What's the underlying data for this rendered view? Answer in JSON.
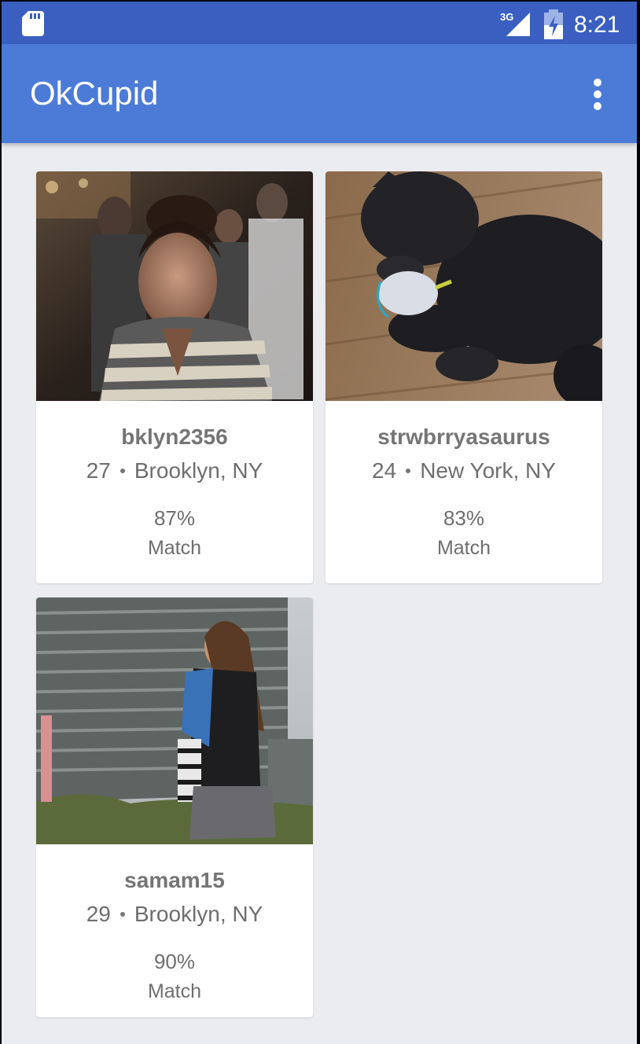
{
  "status_bar": {
    "network": "3G",
    "time": "8:21"
  },
  "app_bar": {
    "title": "OkCupid",
    "overflow_icon": "more-vert-icon"
  },
  "profiles": [
    {
      "username": "bklyn2356",
      "age": "27",
      "location": "Brooklyn, NY",
      "match_percent": "87%",
      "match_label": "Match",
      "photo": "woman-in-striped-shirt-photo"
    },
    {
      "username": "strwbrryasaurus",
      "age": "24",
      "location": "New York, NY",
      "match_percent": "83%",
      "match_label": "Match",
      "photo": "black-cat-with-toy-photo"
    },
    {
      "username": "samam15",
      "age": "29",
      "location": "Brooklyn, NY",
      "match_percent": "90%",
      "match_label": "Match",
      "photo": "woman-in-front-of-building-photo"
    }
  ],
  "colors": {
    "status_bar": "#3a5fc1",
    "app_bar": "#4c7bd7",
    "background": "#ebecf0",
    "card": "#ffffff",
    "text": "#6e6e6e"
  }
}
